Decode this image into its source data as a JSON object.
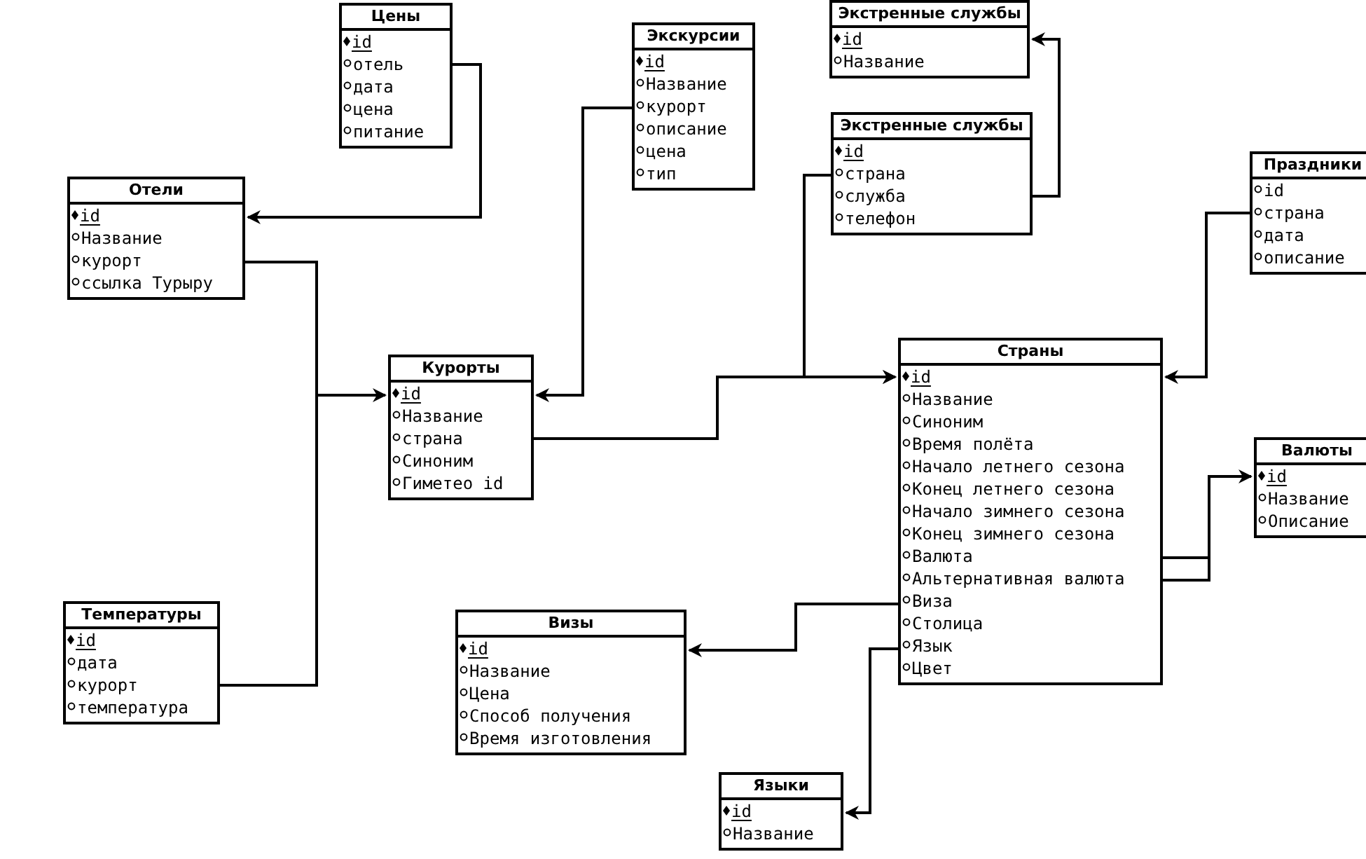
{
  "tables": [
    {
      "title": "Цены",
      "fields": [
        {
          "name": "id",
          "kind": "key"
        },
        {
          "name": "отель",
          "kind": "attr"
        },
        {
          "name": "дата",
          "kind": "attr"
        },
        {
          "name": "цена",
          "kind": "attr"
        },
        {
          "name": "питание",
          "kind": "attr"
        }
      ]
    },
    {
      "title": "Экскурсии",
      "fields": [
        {
          "name": "id",
          "kind": "key"
        },
        {
          "name": "Название",
          "kind": "attr"
        },
        {
          "name": "курорт",
          "kind": "attr"
        },
        {
          "name": "описание",
          "kind": "attr"
        },
        {
          "name": "цена",
          "kind": "attr"
        },
        {
          "name": "тип",
          "kind": "attr"
        }
      ]
    },
    {
      "title": "Экстренные службы",
      "fields": [
        {
          "name": "id",
          "kind": "key"
        },
        {
          "name": "Название",
          "kind": "attr"
        }
      ]
    },
    {
      "title": "Экстренные службы",
      "fields": [
        {
          "name": "id",
          "kind": "key"
        },
        {
          "name": "страна",
          "kind": "attr"
        },
        {
          "name": "служба",
          "kind": "attr"
        },
        {
          "name": "телефон",
          "kind": "attr"
        }
      ]
    },
    {
      "title": "Праздники",
      "fields": [
        {
          "name": "id",
          "kind": "attr"
        },
        {
          "name": "страна",
          "kind": "attr"
        },
        {
          "name": "дата",
          "kind": "attr"
        },
        {
          "name": "описание",
          "kind": "attr"
        }
      ]
    },
    {
      "title": "Отели",
      "fields": [
        {
          "name": "id",
          "kind": "key"
        },
        {
          "name": "Название",
          "kind": "attr"
        },
        {
          "name": "курорт",
          "kind": "attr"
        },
        {
          "name": "ссылка Турыру",
          "kind": "attr"
        }
      ]
    },
    {
      "title": "Курорты",
      "fields": [
        {
          "name": "id",
          "kind": "key"
        },
        {
          "name": "Название",
          "kind": "attr"
        },
        {
          "name": "страна",
          "kind": "attr"
        },
        {
          "name": "Синоним",
          "kind": "attr"
        },
        {
          "name": "Гиметео id",
          "kind": "attr"
        }
      ]
    },
    {
      "title": "Страны",
      "fields": [
        {
          "name": "id",
          "kind": "key"
        },
        {
          "name": "Название",
          "kind": "attr"
        },
        {
          "name": "Синоним",
          "kind": "attr"
        },
        {
          "name": "Время полёта",
          "kind": "attr"
        },
        {
          "name": "Начало летнего сезона",
          "kind": "attr"
        },
        {
          "name": "Конец летнего сезона",
          "kind": "attr"
        },
        {
          "name": "Начало зимнего сезона",
          "kind": "attr"
        },
        {
          "name": "Конец зимнего сезона",
          "kind": "attr"
        },
        {
          "name": "Валюта",
          "kind": "attr"
        },
        {
          "name": "Альтернативная валюта",
          "kind": "attr"
        },
        {
          "name": "Виза",
          "kind": "attr"
        },
        {
          "name": "Столица",
          "kind": "attr"
        },
        {
          "name": "Язык",
          "kind": "attr"
        },
        {
          "name": "Цвет",
          "kind": "attr"
        }
      ]
    },
    {
      "title": "Валюты",
      "fields": [
        {
          "name": "id",
          "kind": "key"
        },
        {
          "name": "Название",
          "kind": "attr"
        },
        {
          "name": "Описание",
          "kind": "attr"
        }
      ]
    },
    {
      "title": "Температуры",
      "fields": [
        {
          "name": "id",
          "kind": "key"
        },
        {
          "name": "дата",
          "kind": "attr"
        },
        {
          "name": "курорт",
          "kind": "attr"
        },
        {
          "name": "температура",
          "kind": "attr"
        }
      ]
    },
    {
      "title": "Визы",
      "fields": [
        {
          "name": "id",
          "kind": "key"
        },
        {
          "name": "Название",
          "kind": "attr"
        },
        {
          "name": "Цена",
          "kind": "attr"
        },
        {
          "name": "Способ получения",
          "kind": "attr"
        },
        {
          "name": "Время изготовления",
          "kind": "attr"
        }
      ]
    },
    {
      "title": "Языки",
      "fields": [
        {
          "name": "id",
          "kind": "key"
        },
        {
          "name": "Название",
          "kind": "attr"
        }
      ]
    }
  ]
}
